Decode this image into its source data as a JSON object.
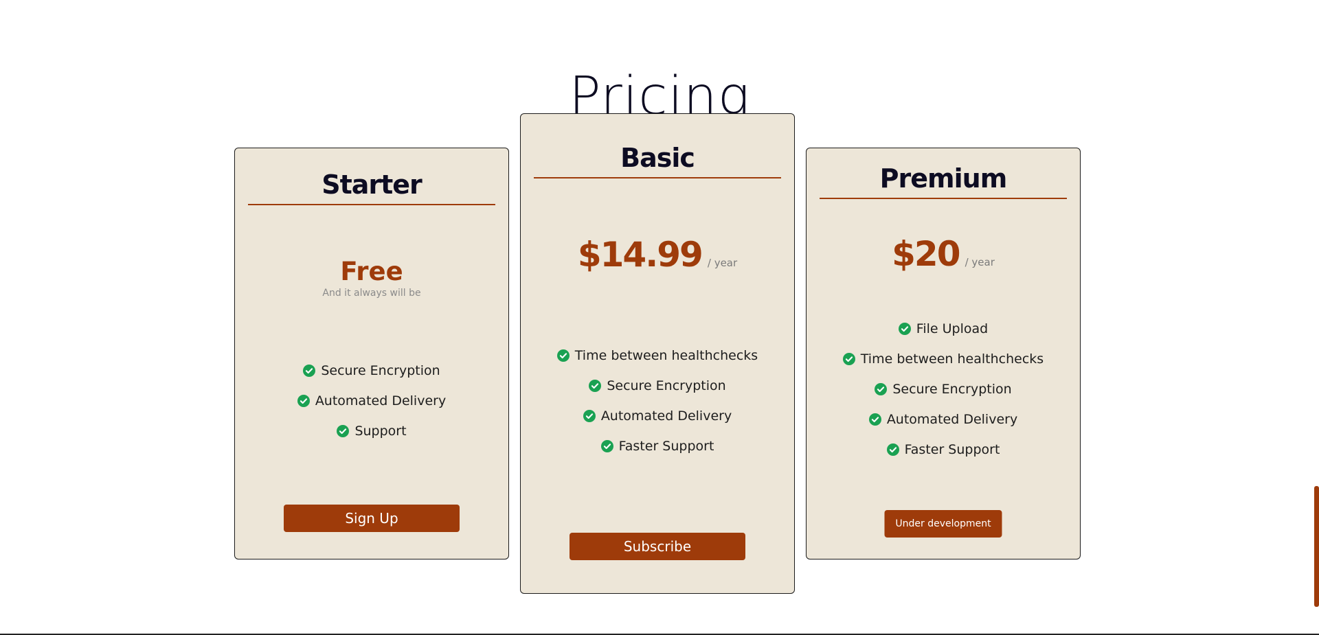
{
  "page": {
    "title": "Pricing"
  },
  "plans": [
    {
      "name": "Starter",
      "price": "Free",
      "period": "",
      "tagline": "And it always will be",
      "features": [
        "Secure Encryption",
        "Automated Delivery",
        "Support"
      ],
      "cta": "Sign Up"
    },
    {
      "name": "Basic",
      "price": "$14.99",
      "period": "/ year",
      "tagline": "",
      "features": [
        "Time between healthchecks",
        "Secure Encryption",
        "Automated Delivery",
        "Faster Support"
      ],
      "cta": "Subscribe"
    },
    {
      "name": "Premium",
      "price": "$20",
      "period": "/ year",
      "tagline": "",
      "features": [
        "File Upload",
        "Time between healthchecks",
        "Secure Encryption",
        "Automated Delivery",
        "Faster Support"
      ],
      "cta": "Under development"
    }
  ],
  "icons": {
    "feature_bullet": "check-circle-icon"
  },
  "colors": {
    "accent": "#9e3b0a",
    "card_background": "#ede6d8",
    "check": "#1aa152",
    "title": "#0d0c22"
  }
}
